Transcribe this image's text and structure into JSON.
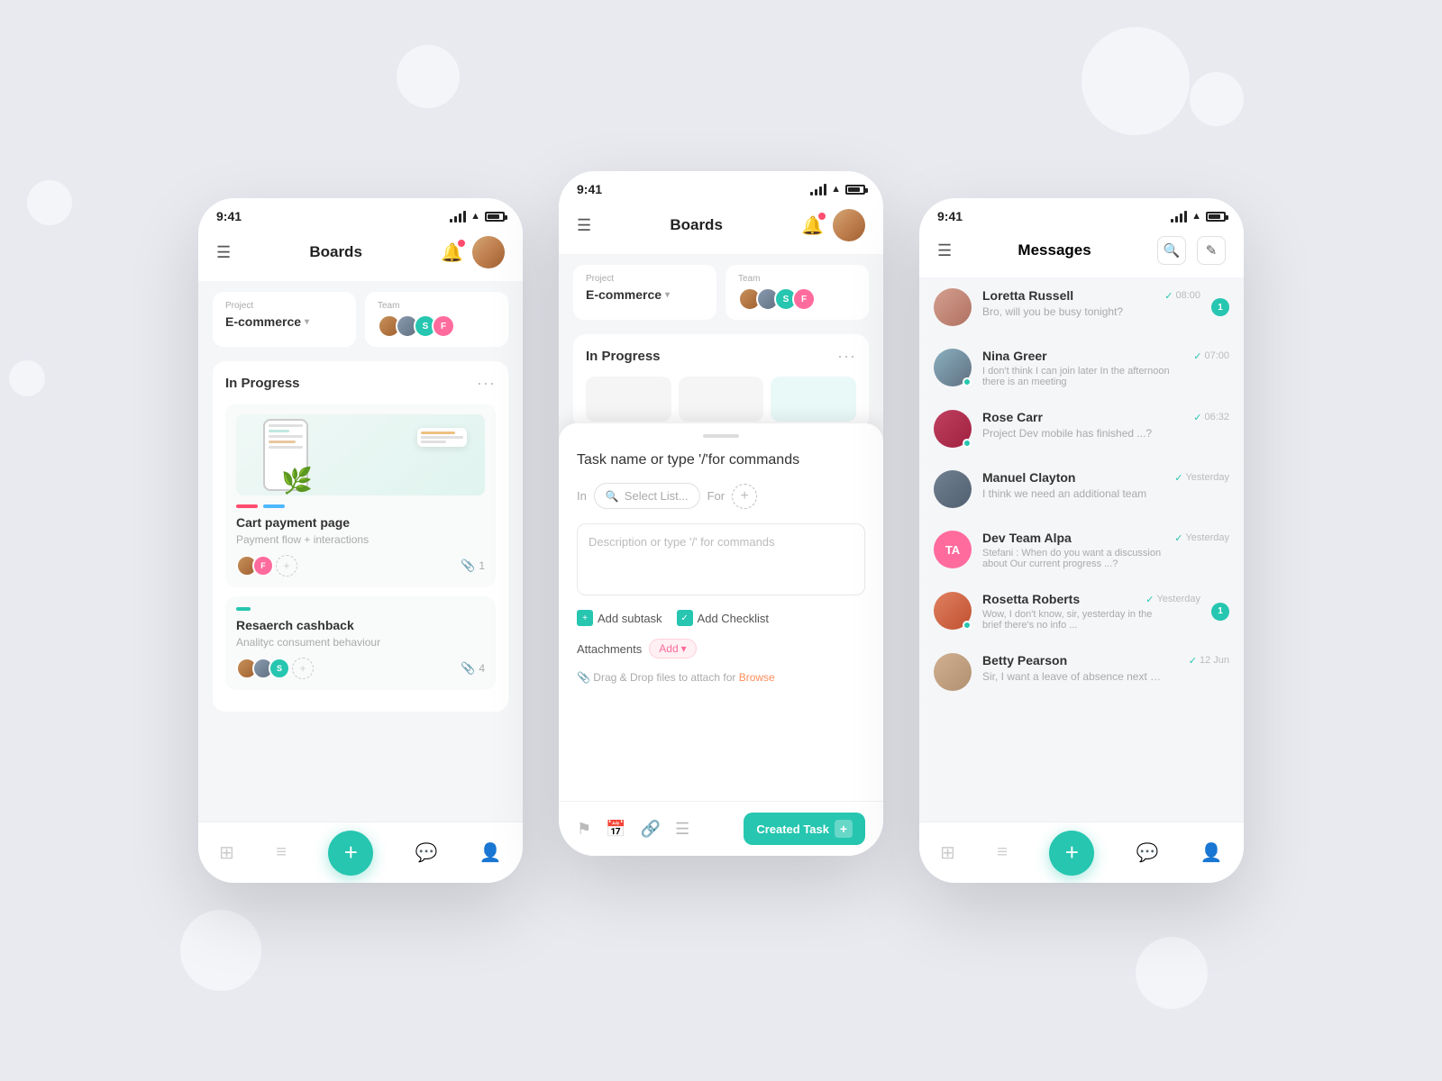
{
  "background": {
    "color": "#e8eaf0"
  },
  "phone1": {
    "status": {
      "time": "9:41"
    },
    "header": {
      "title": "Boards"
    },
    "project": {
      "label": "Project",
      "value": "E-commerce"
    },
    "team": {
      "label": "Team"
    },
    "section1": {
      "title": "In Progress"
    },
    "card1": {
      "title": "Cart payment page",
      "subtitle": "Payment flow + interactions",
      "attach_count": "1"
    },
    "card2": {
      "title": "Resaerch cashback",
      "subtitle": "Analityc consument behaviour",
      "attach_count": "4"
    },
    "nav": {
      "grid": "⊞",
      "list": "≡",
      "chat": "💬",
      "profile": "👤",
      "fab": "+"
    }
  },
  "phone2": {
    "status": {
      "time": "9:41"
    },
    "header": {
      "title": "Boards"
    },
    "project": {
      "label": "Project",
      "value": "E-commerce"
    },
    "team": {
      "label": "Team"
    },
    "section1": {
      "title": "In Progress"
    },
    "modal": {
      "task_placeholder": "Task name or type '/'for commands",
      "in_label": "In",
      "select_placeholder": "Select List...",
      "for_label": "For",
      "desc_placeholder": "Description or type '/' for commands",
      "add_subtask": "Add subtask",
      "add_checklist": "Add Checklist",
      "attachments_label": "Attachments",
      "add_label": "Add",
      "drag_drop": "Drag & Drop files to attach for",
      "browse": "Browse",
      "created_task": "Created Task"
    }
  },
  "phone3": {
    "status": {
      "time": "9:41"
    },
    "header": {
      "title": "Messages"
    },
    "messages": [
      {
        "name": "Loretta Russell",
        "time": "08:00",
        "preview": "Bro, will you be busy tonight?",
        "unread": "1",
        "online": false,
        "checked": true
      },
      {
        "name": "Nina Greer",
        "time": "07:00",
        "preview": "I don't think I can join later In the afternoon there is an meeting",
        "unread": null,
        "online": true,
        "checked": true
      },
      {
        "name": "Rose Carr",
        "time": "06:32",
        "preview": "Project Dev mobile has finished ...?",
        "unread": null,
        "online": true,
        "checked": true
      },
      {
        "name": "Manuel Clayton",
        "time": "Yesterday",
        "preview": "I think we need an additional team",
        "unread": null,
        "online": false,
        "checked": true
      },
      {
        "name": "Dev Team Alpa",
        "time": "Yesterday",
        "preview": "Stefani : When do you want a discussion about Our current progress ...?",
        "unread": null,
        "online": false,
        "checked": true,
        "initials": "TA"
      },
      {
        "name": "Rosetta Roberts",
        "time": "Yesterday",
        "preview": "Wow, I don't know, sir, yesterday in the brief there's no info ...",
        "unread": "1",
        "online": true,
        "checked": true
      },
      {
        "name": "Betty Pearson",
        "time": "12 Jun",
        "preview": "Sir, I want a leave of absence next week",
        "unread": null,
        "online": false,
        "checked": true
      }
    ]
  }
}
